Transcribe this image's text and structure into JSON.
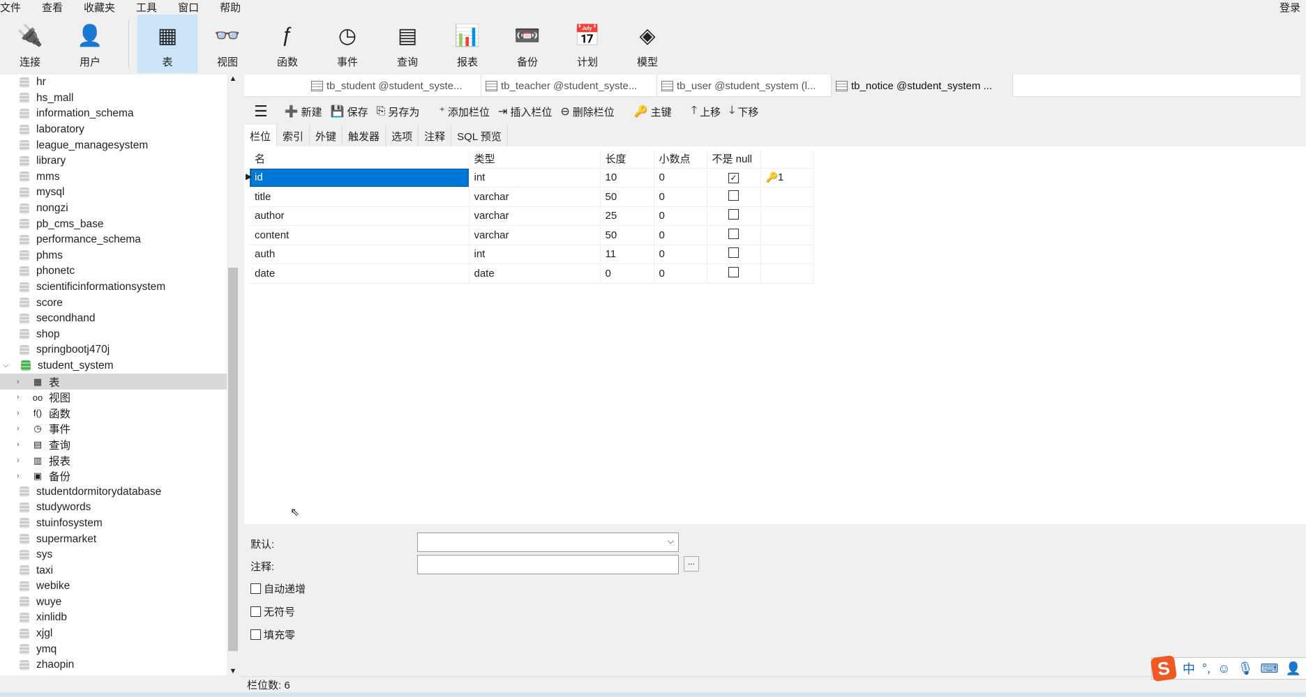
{
  "menu": [
    "文件",
    "查看",
    "收藏夹",
    "工具",
    "窗口",
    "帮助"
  ],
  "login": "登录",
  "toolbar": [
    {
      "label": "连接",
      "icon": "plug-icon"
    },
    {
      "label": "用户",
      "icon": "user-icon"
    },
    {
      "label": "表",
      "icon": "table-icon",
      "active": true
    },
    {
      "label": "视图",
      "icon": "view-icon"
    },
    {
      "label": "函数",
      "icon": "function-icon"
    },
    {
      "label": "事件",
      "icon": "event-icon"
    },
    {
      "label": "查询",
      "icon": "query-icon"
    },
    {
      "label": "报表",
      "icon": "report-icon"
    },
    {
      "label": "备份",
      "icon": "backup-icon"
    },
    {
      "label": "计划",
      "icon": "schedule-icon"
    },
    {
      "label": "模型",
      "icon": "model-icon"
    }
  ],
  "tree": {
    "before": [
      "hr",
      "hs_mall",
      "information_schema",
      "laboratory",
      "league_managesystem",
      "library",
      "mms",
      "mysql",
      "nongzi",
      "pb_cms_base",
      "performance_schema",
      "phms",
      "phonetc",
      "scientificinformationsystem",
      "score",
      "secondhand",
      "shop",
      "springbootj470j"
    ],
    "open_db": "student_system",
    "children": [
      {
        "label": "表",
        "icon": "▦"
      },
      {
        "label": "视图",
        "icon": "oo"
      },
      {
        "label": "函数",
        "icon": "f()"
      },
      {
        "label": "事件",
        "icon": "◷"
      },
      {
        "label": "查询",
        "icon": "▤"
      },
      {
        "label": "报表",
        "icon": "▥"
      },
      {
        "label": "备份",
        "icon": "▣"
      }
    ],
    "after": [
      "studentdormitorydatabase",
      "studywords",
      "stuinfosystem",
      "supermarket",
      "sys",
      "taxi",
      "webike",
      "wuye",
      "xinlidb",
      "xjgl",
      "ymq",
      "zhaopin"
    ]
  },
  "tabs": [
    "tb_student @student_syste...",
    "tb_teacher @student_syste...",
    "tb_user @student_system (l...",
    "tb_notice @student_system ..."
  ],
  "objbar": [
    {
      "label": "新建",
      "icon": "➕"
    },
    {
      "label": "保存",
      "icon": "💾"
    },
    {
      "label": "另存为",
      "icon": "⎘"
    },
    {
      "label": "添加栏位",
      "icon": "⁺"
    },
    {
      "label": "插入栏位",
      "icon": "⇥"
    },
    {
      "label": "删除栏位",
      "icon": "⊖"
    },
    {
      "label": "主键",
      "icon": "🔑"
    },
    {
      "label": "上移",
      "icon": "🡑"
    },
    {
      "label": "下移",
      "icon": "🡓"
    }
  ],
  "subtabs": [
    "栏位",
    "索引",
    "外键",
    "触发器",
    "选项",
    "注释",
    "SQL 预览"
  ],
  "grid": {
    "headers": [
      "名",
      "类型",
      "长度",
      "小数点",
      "不是 null",
      ""
    ],
    "rows": [
      [
        "id",
        "int",
        "10",
        "0",
        true,
        "1"
      ],
      [
        "title",
        "varchar",
        "50",
        "0",
        false,
        ""
      ],
      [
        "author",
        "varchar",
        "25",
        "0",
        false,
        ""
      ],
      [
        "content",
        "varchar",
        "50",
        "0",
        false,
        ""
      ],
      [
        "auth",
        "int",
        "11",
        "0",
        false,
        ""
      ],
      [
        "date",
        "date",
        "0",
        "0",
        false,
        ""
      ]
    ]
  },
  "props": {
    "default_label": "默认:",
    "comment_label": "注释:",
    "ellipsis": "...",
    "auto_increment": "自动递增",
    "unsigned": "无符号",
    "zerofill": "填充零"
  },
  "status": "栏位数: 6",
  "ime": {
    "lang": "中",
    "punct": "°,"
  }
}
